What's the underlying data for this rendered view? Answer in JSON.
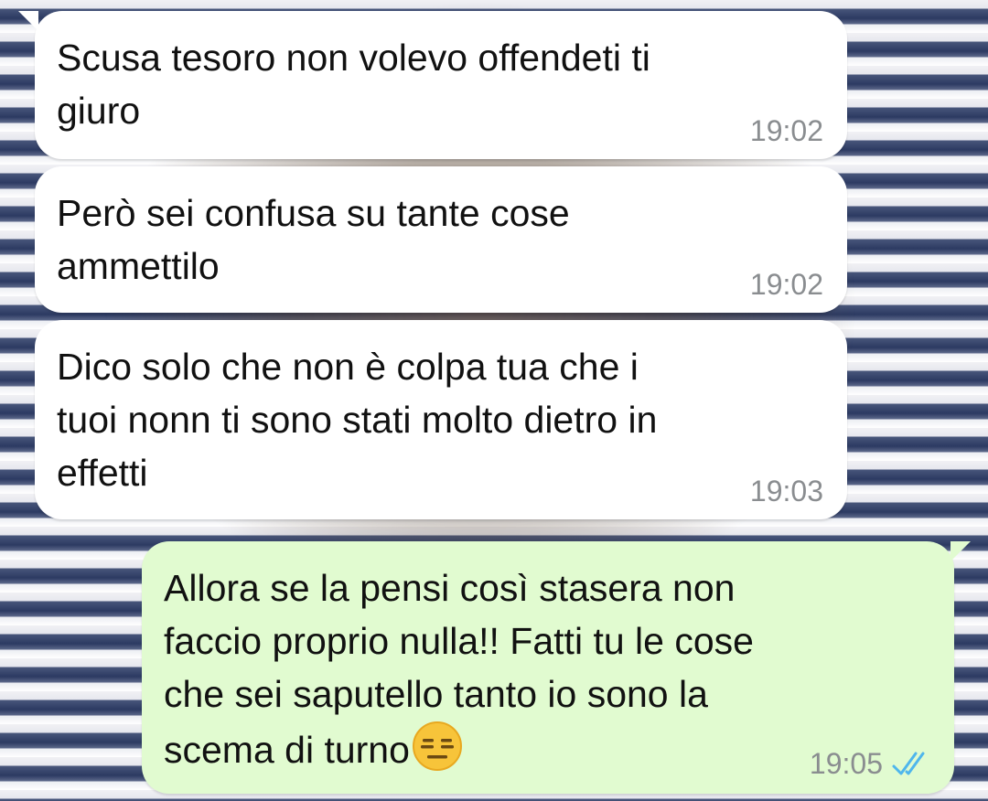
{
  "messages": [
    {
      "direction": "incoming",
      "text": "Scusa tesoro non volevo offendeti ti\ngiuro",
      "time": "19:02"
    },
    {
      "direction": "incoming",
      "text": "Però sei confusa su tante cose\nammettilo",
      "time": "19:02"
    },
    {
      "direction": "incoming",
      "text": "Dico solo che non è colpa tua che i\ntuoi nonn ti sono stati molto dietro in\neffetti",
      "time": "19:03"
    },
    {
      "direction": "outgoing",
      "text": "Allora se la pensi così stasera non\nfaccio proprio nulla!! Fatti tu le cose\nche sei saputello tanto io sono la\nscema di turno",
      "time": "19:05",
      "status_icon": "double-check-read-icon",
      "trailing_emoji": "expressionless-face-emoji"
    }
  ],
  "colors": {
    "incoming_bubble": "#ffffff",
    "outgoing_bubble": "#e1fbd0",
    "timestamp": "#8a8d90",
    "read_ticks": "#4fb6ec"
  }
}
